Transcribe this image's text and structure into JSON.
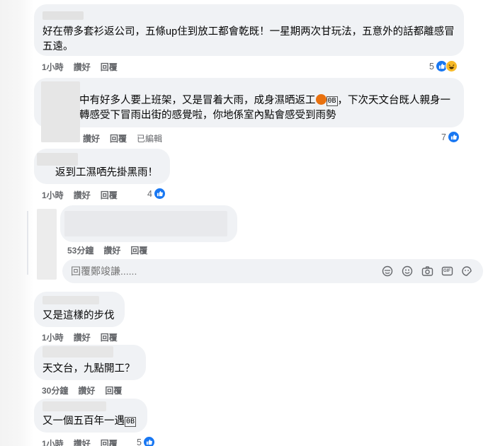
{
  "comments": [
    {
      "text": "好在帶多套衫返公司，五條up住到放工都會乾既！一星期两次甘玩法，五意外的話都離感冒五遠。",
      "time": "1小時",
      "like": "讚好",
      "reply": "回覆",
      "edited": "",
      "reactions": "5",
      "reaction_types": [
        "like-icon",
        "haha-icon"
      ]
    },
    {
      "text_pre": "中有好多人要上班架，又是冒着大雨，成身濕晒返工",
      "text_post": "，下次天文台既人親身一轉感受下冒雨出街的感覺啦，你地係室內點會感受到雨勢",
      "time": "",
      "like": "讚好",
      "reply": "回覆",
      "edited": "已編輯",
      "reactions": "7",
      "reaction_types": [
        "like-icon"
      ]
    },
    {
      "text": "返到工濕哂先掛黑雨！",
      "time": "1小時",
      "like": "讚好",
      "reply": "回覆",
      "reactions": "4",
      "reaction_types": [
        "like-icon"
      ]
    },
    {
      "text": "",
      "time": "53分鐘",
      "like": "讚好",
      "reply": "回覆",
      "reactions": "",
      "reaction_types": []
    },
    {
      "text": "又是這樣的步伐",
      "time": "1小時",
      "like": "讚好",
      "reply": "回覆",
      "reactions": "",
      "reaction_types": []
    },
    {
      "text": "天文台，九點開工？",
      "time": "30分鐘",
      "like": "讚好",
      "reply": "回覆",
      "reactions": "",
      "reaction_types": []
    },
    {
      "text": "又一個五百年一遇",
      "time": "1小時",
      "like": "讚好",
      "reply": "回覆",
      "reactions": "5",
      "reaction_types": [
        "like-icon"
      ]
    }
  ],
  "emoji_box": "😂",
  "reply_box": {
    "placeholder": "回覆鄭竣謙......",
    "icons": [
      "sticker-face-icon",
      "emoji-icon",
      "camera-icon",
      "gif-icon",
      "sticker-icon"
    ],
    "gif_label": "GIF"
  },
  "colors": {
    "bubble": "#f0f2f5",
    "like_blue": "#1877f2",
    "meta_gray": "#65676b"
  }
}
